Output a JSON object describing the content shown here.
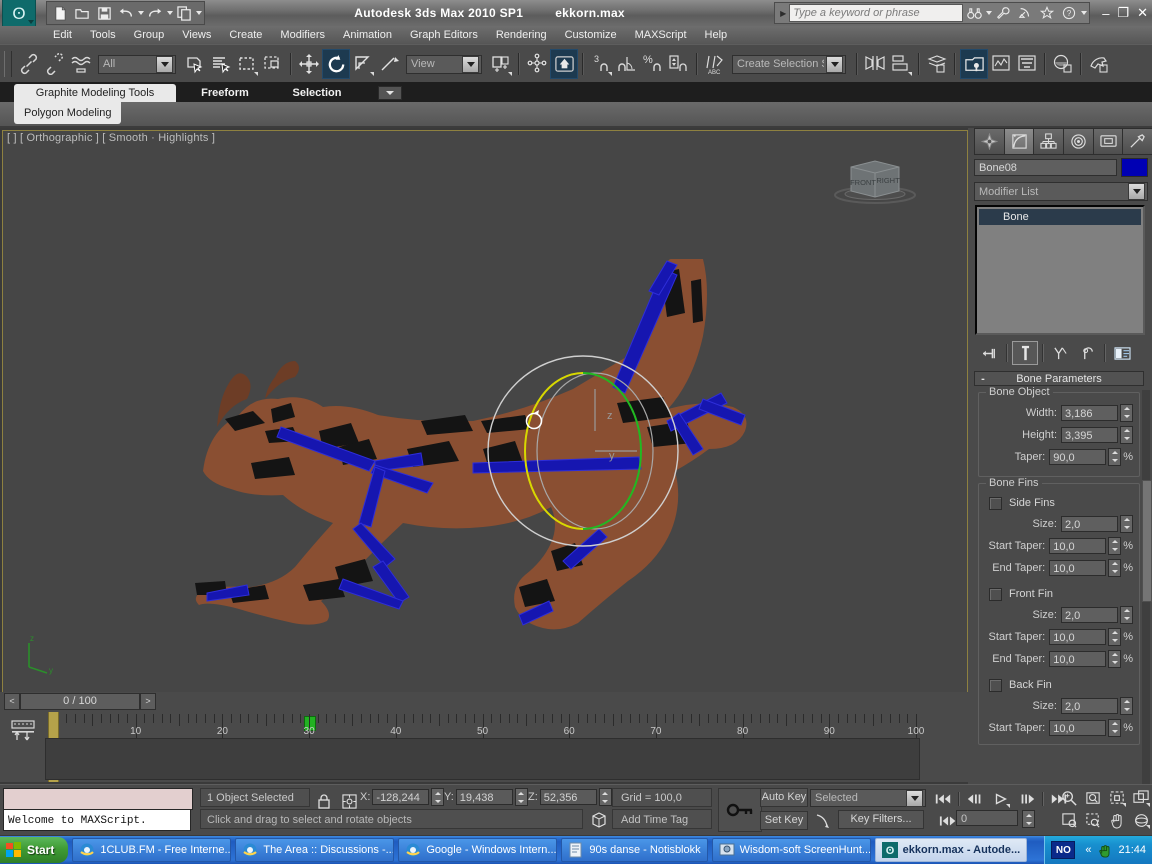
{
  "titlebar": {
    "app_title": "Autodesk 3ds Max  2010 SP1",
    "file_name": "ekkorn.max",
    "search_placeholder": "Type a keyword or phrase",
    "logo_icon": "max-swirl-logo-icon",
    "quick_access": [
      {
        "name": "new-file-icon",
        "label": "New"
      },
      {
        "name": "open-file-icon",
        "label": "Open"
      },
      {
        "name": "save-file-icon",
        "label": "Save"
      },
      {
        "name": "undo-icon",
        "label": "Undo"
      },
      {
        "name": "redo-icon",
        "label": "Redo"
      },
      {
        "name": "copy-icon",
        "label": "Copy"
      }
    ],
    "search_tools": [
      "binoculars-icon",
      "wrench-icon",
      "satellite-icon",
      "star-icon",
      "help-icon"
    ],
    "window_buttons": {
      "minimize": "–",
      "restore": "❐",
      "close": "✕"
    }
  },
  "menubar": {
    "items": [
      "Edit",
      "Tools",
      "Group",
      "Views",
      "Create",
      "Modifiers",
      "Animation",
      "Graph Editors",
      "Rendering",
      "Customize",
      "MAXScript",
      "Help"
    ]
  },
  "toolbar": {
    "selection_filter": "All",
    "reference_coord": "View",
    "named_selection_set": "Create Selection Se",
    "angle_snap_label": "3",
    "percent_snap_label": "%",
    "buttons": [
      "select-link-icon",
      "unlink-selection-icon",
      "bind-to-space-warp-icon",
      "select-object-icon",
      "select-by-name-icon",
      "rectangular-selection-region-icon",
      "window-crossing-icon",
      "select-and-move-icon",
      "select-and-rotate-icon",
      "select-and-scale-icon",
      "mirror-icon",
      "align-icon",
      "layer-manager-icon",
      "curve-editor-icon",
      "schematic-view-icon",
      "material-editor-icon",
      "render-setup-icon",
      "render-frame-window-icon",
      "render-production-icon"
    ]
  },
  "ribbon": {
    "tabs": [
      {
        "label": "Graphite Modeling Tools",
        "active": true
      },
      {
        "label": "Freeform",
        "active": false
      },
      {
        "label": "Selection",
        "active": false
      }
    ],
    "panel_tab": "Polygon Modeling",
    "minimize_icon": "chevron-down-icon"
  },
  "viewport": {
    "label": "[   ] [ Orthographic ] [ Smooth · Highlights ]",
    "viewcube": {
      "front": "FRONT",
      "right": "RIGHT"
    },
    "gizmo": {
      "axis_z": "z",
      "axis_y": "y",
      "rotate_cursor": "rotate-cursor-icon"
    },
    "axis_tripod": {
      "x": "x",
      "y": "y",
      "z": "z"
    },
    "colors": {
      "background": "#464646",
      "model_fill": "#8a4f32",
      "bone_color": "#1616b0",
      "gizmo_y_circle": "#d8d800",
      "gizmo_z_circle": "#22b822",
      "gizmo_outer": "#cfcfcf",
      "border": "#8e8140"
    }
  },
  "command_panel": {
    "tabs": [
      {
        "name": "create-tab",
        "icon": "create-star-icon",
        "selected": false
      },
      {
        "name": "modify-tab",
        "icon": "modify-curve-icon",
        "selected": true
      },
      {
        "name": "hierarchy-tab",
        "icon": "hierarchy-icon",
        "selected": false
      },
      {
        "name": "motion-tab",
        "icon": "motion-wheel-icon",
        "selected": false
      },
      {
        "name": "display-tab",
        "icon": "display-monitor-icon",
        "selected": false
      },
      {
        "name": "utilities-tab",
        "icon": "utilities-hammer-icon",
        "selected": false
      }
    ],
    "object_name": "Bone08",
    "object_color": "#0000b4",
    "modifier_list_label": "Modifier List",
    "stack": [
      {
        "label": "Bone",
        "selected": true
      }
    ],
    "stack_tools": [
      {
        "name": "pin-stack-icon"
      },
      {
        "name": "show-end-result-icon",
        "selected": true
      },
      {
        "name": "make-unique-icon"
      },
      {
        "name": "remove-modifier-icon"
      },
      {
        "name": "configure-modifier-sets-icon"
      }
    ],
    "rollout": {
      "title": "Bone Parameters",
      "marker": "-",
      "groups": [
        {
          "label": "Bone Object",
          "fields": [
            {
              "label": "Width:",
              "value": "3,186",
              "unit": ""
            },
            {
              "label": "Height:",
              "value": "3,395",
              "unit": ""
            },
            {
              "label": "Taper:",
              "value": "90,0",
              "unit": "%"
            }
          ]
        },
        {
          "label": "Bone Fins",
          "checkboxes": [
            {
              "label": "Side Fins",
              "checked": false
            },
            {
              "label": "Front Fin",
              "checked": false
            },
            {
              "label": "Back Fin",
              "checked": false
            }
          ],
          "sections": [
            {
              "checkbox": "Side Fins",
              "fields": [
                {
                  "label": "Size:",
                  "value": "2,0",
                  "unit": ""
                },
                {
                  "label": "Start Taper:",
                  "value": "10,0",
                  "unit": "%"
                },
                {
                  "label": "End Taper:",
                  "value": "10,0",
                  "unit": "%"
                }
              ]
            },
            {
              "checkbox": "Front Fin",
              "fields": [
                {
                  "label": "Size:",
                  "value": "2,0",
                  "unit": ""
                },
                {
                  "label": "Start Taper:",
                  "value": "10,0",
                  "unit": "%"
                },
                {
                  "label": "End Taper:",
                  "value": "10,0",
                  "unit": "%"
                }
              ]
            },
            {
              "checkbox": "Back Fin",
              "fields": [
                {
                  "label": "Size:",
                  "value": "2,0",
                  "unit": ""
                },
                {
                  "label": "Start Taper:",
                  "value": "10,0",
                  "unit": "%"
                }
              ]
            }
          ]
        }
      ]
    }
  },
  "timeline": {
    "prev_label": "<",
    "next_label": ">",
    "frame_readout": "0 / 100",
    "ruler_labels": [
      "10",
      "20",
      "30",
      "40",
      "50",
      "60",
      "70",
      "80",
      "90",
      "100"
    ],
    "range_start": 0,
    "range_end": 100,
    "current_frame": 0,
    "key_frame": 30
  },
  "status": {
    "maxscript_listener_output": "Welcome to MAXScript.",
    "selection_status": "1 Object Selected",
    "prompt": "Click and drag to select and rotate objects",
    "coords": [
      {
        "axis": "X:",
        "value": "-128,244"
      },
      {
        "axis": "Y:",
        "value": "19,438"
      },
      {
        "axis": "Z:",
        "value": "52,356"
      }
    ],
    "grid": "Grid = 100,0",
    "add_time_tag": "Add Time Tag",
    "key_mode_icon": "key-icon",
    "auto_key": "Auto Key",
    "set_key": "Set Key",
    "key_filter_set": "Selected",
    "key_filters": "Key Filters...",
    "frame_field": "0",
    "lock_icon": "lock-icon",
    "absolute_mode_icon": "absolute-relative-icon",
    "playback_buttons": [
      "go-to-start-icon",
      "previous-frame-icon",
      "play-icon",
      "next-frame-icon",
      "go-to-end-icon"
    ],
    "view_nav_buttons": [
      "zoom-icon",
      "zoom-all-icon",
      "zoom-extents-icon",
      "zoom-extents-all-icon",
      "field-of-view-icon",
      "zoom-region-icon",
      "pan-icon",
      "arc-rotate-icon",
      "maximize-viewport-icon"
    ]
  },
  "taskbar": {
    "start_label": "Start",
    "items": [
      {
        "label": "1CLUB.FM - Free Interne...",
        "icon": "internet-explorer-icon",
        "active": false
      },
      {
        "label": "The Area :: Discussions -...",
        "icon": "internet-explorer-icon",
        "active": false
      },
      {
        "label": "Google - Windows Intern...",
        "icon": "internet-explorer-icon",
        "active": false
      },
      {
        "label": "90s danse - Notisblokk",
        "icon": "notepad-icon",
        "active": false
      },
      {
        "label": "Wisdom-soft ScreenHunt...",
        "icon": "screenhunter-icon",
        "active": false
      },
      {
        "label": "ekkorn.max - Autode...",
        "icon": "max-swirl-logo-icon",
        "active": true
      }
    ],
    "tray_badge": "NO",
    "tray_expand": "«",
    "tray_icon": "hand-icon",
    "clock": "21:44"
  }
}
